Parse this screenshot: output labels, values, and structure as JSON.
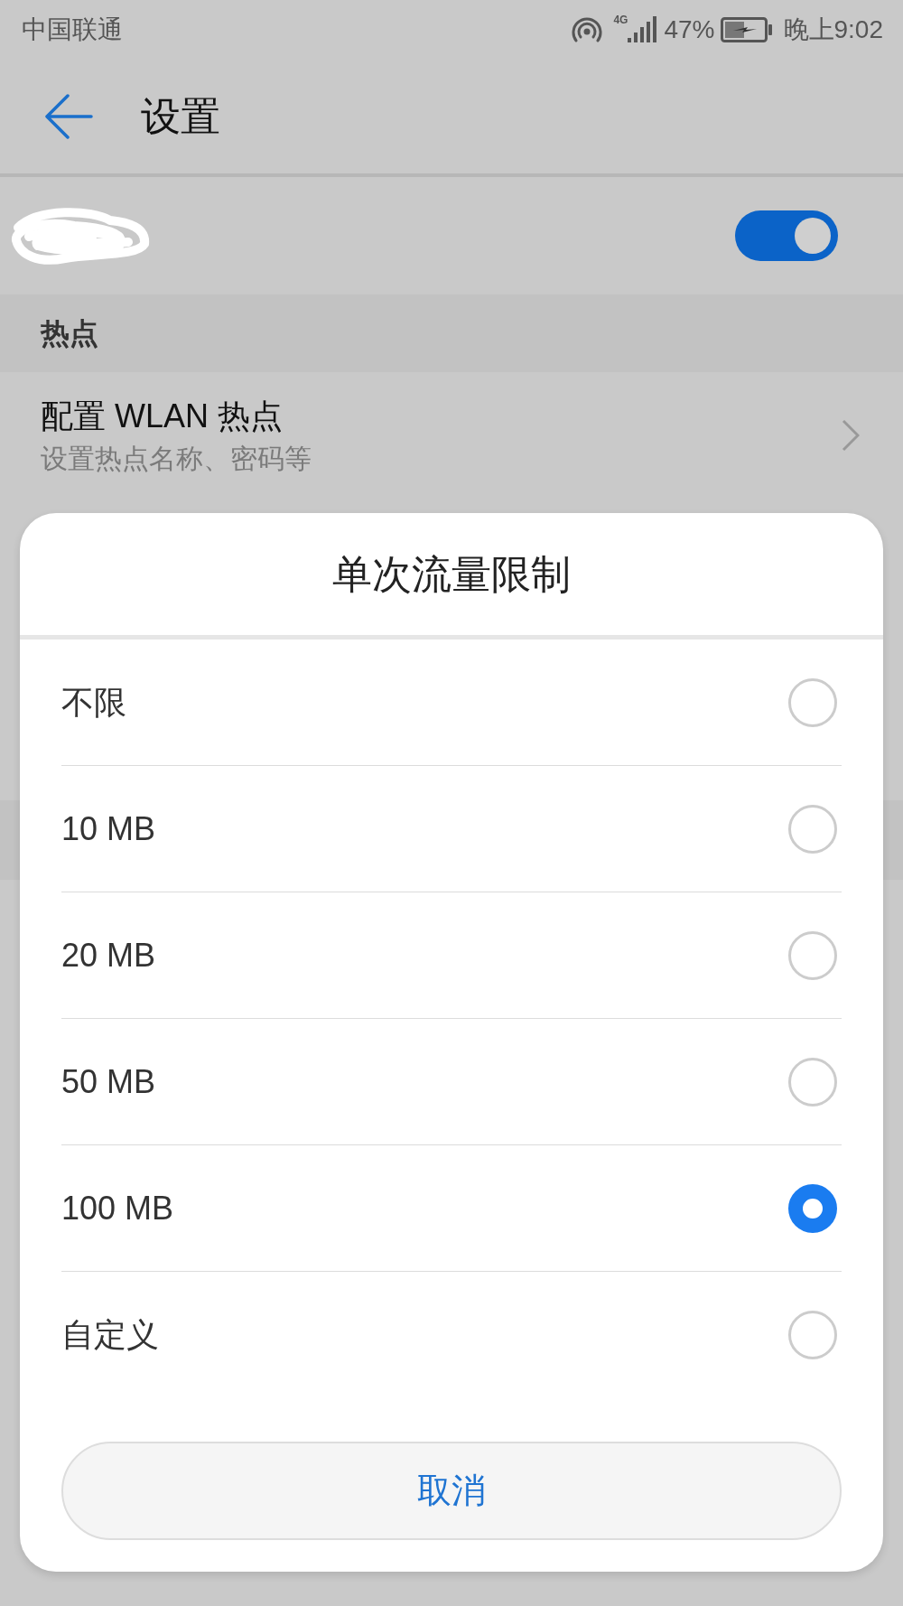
{
  "status_bar": {
    "carrier": "中国联通",
    "network": "4G",
    "battery": "47%",
    "time": "晚上9:02"
  },
  "app_bar": {
    "title": "设置"
  },
  "switch": {
    "on": true
  },
  "section": {
    "header": "热点",
    "item": {
      "title": "配置 WLAN 热点",
      "subtitle": "设置热点名称、密码等"
    }
  },
  "dialog": {
    "title": "单次流量限制",
    "options": [
      {
        "label": "不限",
        "selected": false
      },
      {
        "label": "10 MB",
        "selected": false
      },
      {
        "label": "20 MB",
        "selected": false
      },
      {
        "label": "50 MB",
        "selected": false
      },
      {
        "label": "100 MB",
        "selected": true
      },
      {
        "label": "自定义",
        "selected": false
      }
    ],
    "cancel": "取消"
  }
}
